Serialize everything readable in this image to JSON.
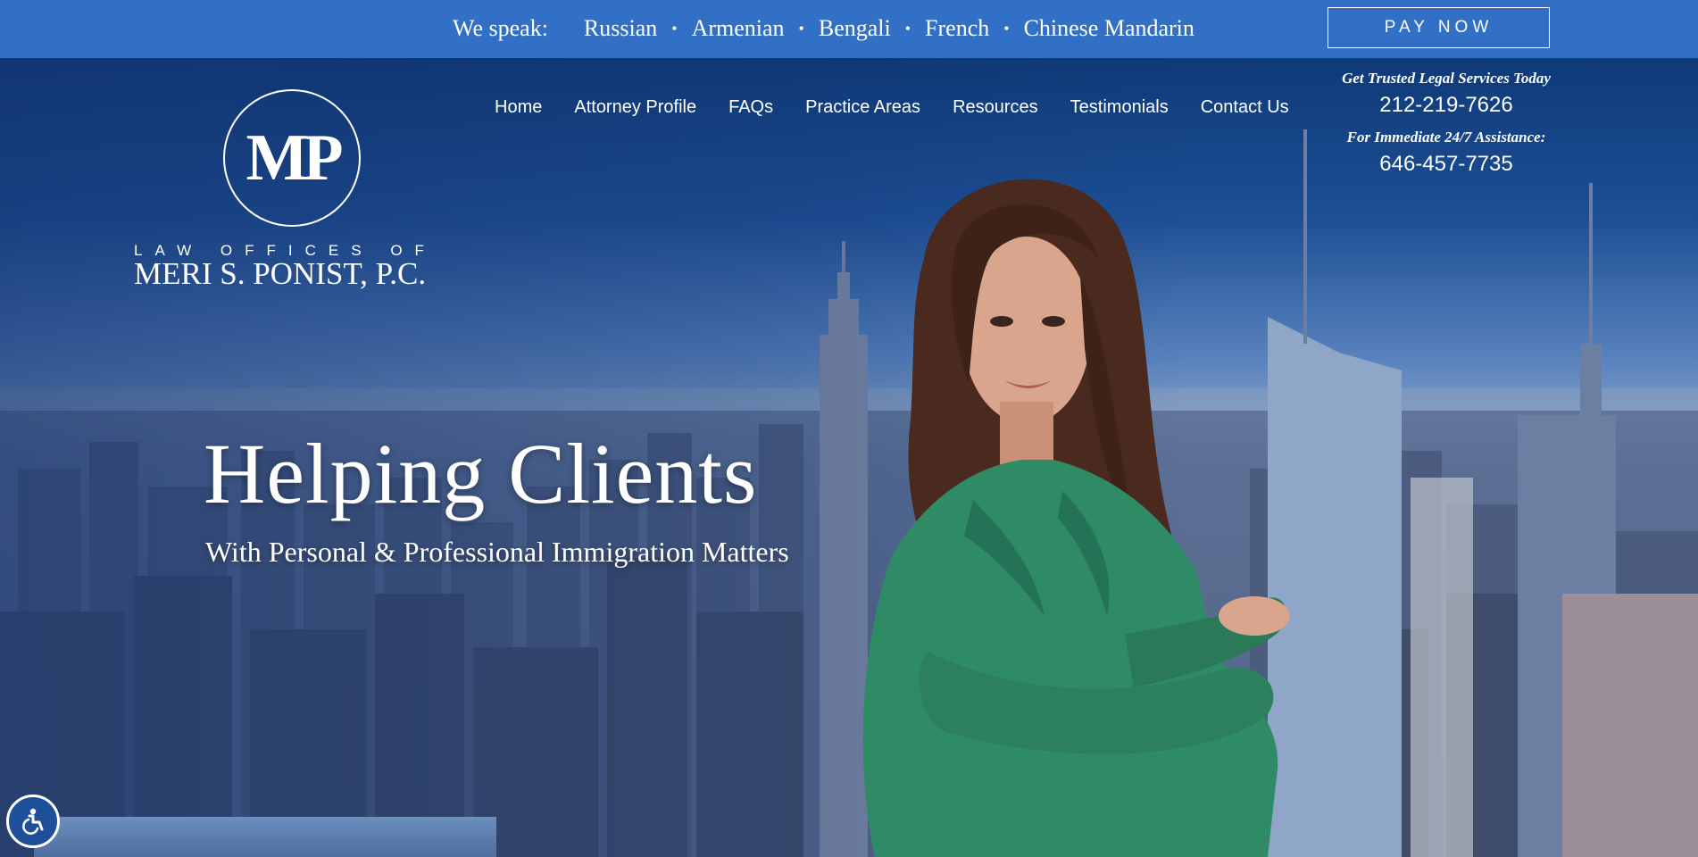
{
  "topbar": {
    "we_speak": "We speak:",
    "languages": [
      "Russian",
      "Armenian",
      "Bengali",
      "French",
      "Chinese Mandarin"
    ],
    "separator": "•",
    "pay_now": "PAY NOW"
  },
  "logo": {
    "monogram": "MP",
    "small": "LAW OFFICES OF",
    "name": "MERI S. PONIST, P.C."
  },
  "nav": {
    "items": [
      "Home",
      "Attorney Profile",
      "FAQs",
      "Practice Areas",
      "Resources",
      "Testimonials",
      "Contact Us"
    ]
  },
  "contact": {
    "tag1": "Get Trusted Legal Services Today",
    "phone1": "212-219-7626",
    "tag2": "For Immediate 24/7 Assistance:",
    "phone2": "646-457-7735"
  },
  "hero": {
    "headline": "Helping Clients",
    "subhead": "With Personal & Professional Immigration Matters"
  },
  "colors": {
    "topbar": "#3270c6",
    "blouse": "#2f8a66",
    "hair": "#4a2a1e"
  },
  "icons": {
    "accessibility": "accessibility-icon"
  }
}
